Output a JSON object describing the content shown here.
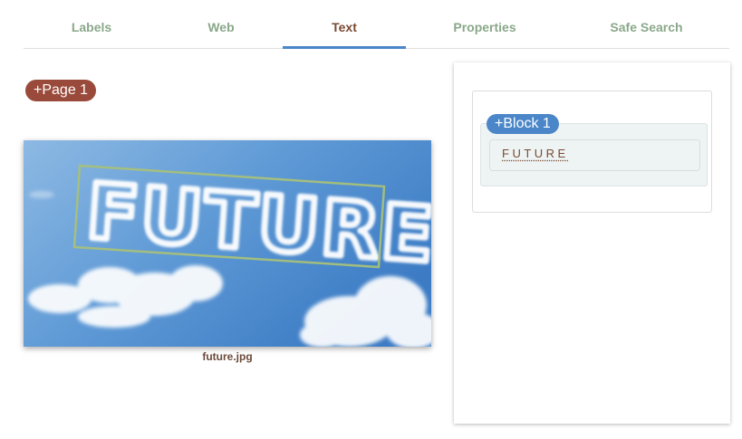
{
  "tabs": [
    {
      "label": "Labels",
      "active": false
    },
    {
      "label": "Web",
      "active": false
    },
    {
      "label": "Text",
      "active": true
    },
    {
      "label": "Properties",
      "active": false
    },
    {
      "label": "Safe Search",
      "active": false
    }
  ],
  "image": {
    "filename": "future.jpg",
    "detected_text": "FUTURE"
  },
  "results": {
    "page_label": "+Page 1",
    "block_label": "+Block 1",
    "words": [
      "FUTURE"
    ]
  },
  "colors": {
    "active_tab_text": "#7a4a33",
    "inactive_tab_text": "#8aa88a",
    "tab_indicator": "#4a86c8",
    "page_chip": "#9a4a3a",
    "block_chip": "#4a86c8",
    "bounding_box": "#a7c07a"
  }
}
